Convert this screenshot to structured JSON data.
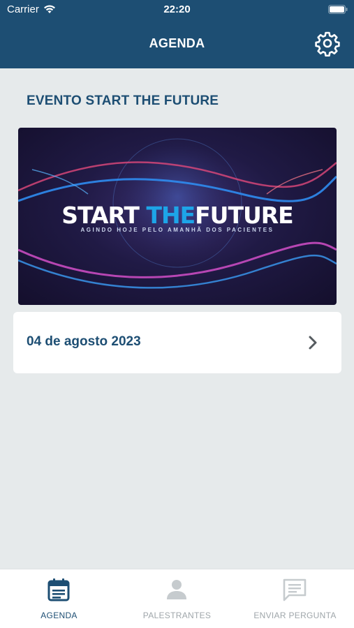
{
  "status_bar": {
    "carrier": "Carrier",
    "time": "22:20"
  },
  "nav": {
    "title": "AGENDA",
    "settings_icon": "gear-icon"
  },
  "event": {
    "title": "EVENTO START THE FUTURE",
    "banner": {
      "word_start": "START",
      "word_the": "THE",
      "word_future": "FUTURE",
      "subtitle": "AGINDO HOJE PELO AMANHÃ DOS PACIENTES"
    },
    "date": "04 de agosto 2023"
  },
  "tabbar": {
    "tabs": [
      {
        "label": "AGENDA",
        "icon": "calendar-icon",
        "active": true
      },
      {
        "label": "PALESTRANTES",
        "icon": "person-icon",
        "active": false
      },
      {
        "label": "ENVIAR PERGUNTA",
        "icon": "chat-icon",
        "active": false
      }
    ]
  },
  "colors": {
    "primary": "#1d4e73",
    "background": "#e6eaeb",
    "inactive": "#9fa6aa",
    "accent": "#1da5e8"
  }
}
